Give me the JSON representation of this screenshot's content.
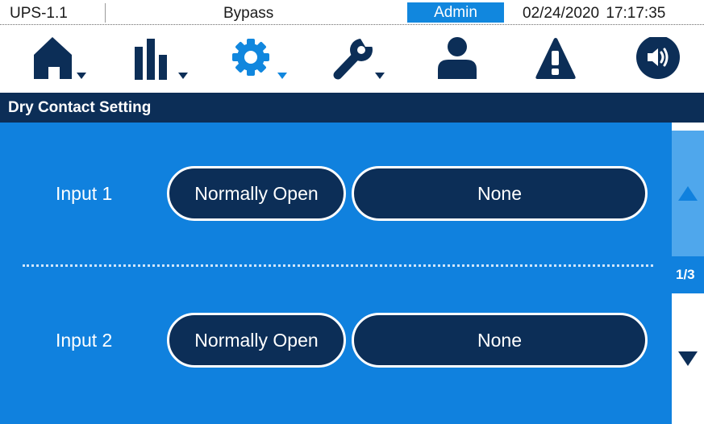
{
  "status": {
    "device": "UPS-1.1",
    "mode": "Bypass",
    "user": "Admin",
    "datetime": "02/24/2020  17:17:35"
  },
  "nav": {
    "items": [
      {
        "icon": "home-icon",
        "has_menu": true
      },
      {
        "icon": "bar-chart-icon",
        "has_menu": true
      },
      {
        "icon": "gear-icon",
        "has_menu": true,
        "active": true
      },
      {
        "icon": "wrench-icon",
        "has_menu": true
      },
      {
        "icon": "user-icon",
        "has_menu": false
      },
      {
        "icon": "warning-icon",
        "has_menu": false
      },
      {
        "icon": "speaker-icon",
        "has_menu": false
      }
    ]
  },
  "page": {
    "title": "Dry Contact Setting"
  },
  "inputs": [
    {
      "label": "Input 1",
      "contact_type": "Normally Open",
      "function": "None"
    },
    {
      "label": "Input 2",
      "contact_type": "Normally Open",
      "function": "None"
    }
  ],
  "pager": {
    "indicator": "1/3"
  },
  "colors": {
    "navy": "#0c2e57",
    "blue": "#1081de",
    "light_blue": "#4fa7ec",
    "accent_gear": "#1187de"
  }
}
